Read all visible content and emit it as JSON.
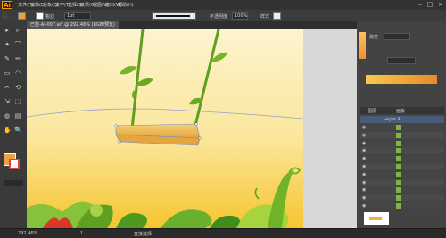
{
  "app": {
    "logo_text": "Ai"
  },
  "menu": {
    "items": [
      "文件(F)",
      "编辑(E)",
      "对象(O)",
      "文字(T)",
      "选择(S)",
      "效果(C)",
      "视图(V)",
      "窗口(W)",
      "帮助(H)"
    ]
  },
  "controlbar": {
    "stroke_label": "描边",
    "stroke_weight": "1pt",
    "opacity_label": "不透明度",
    "opacity_value": "100%",
    "style_label": "样式"
  },
  "document": {
    "tab_label": "已签-AI-007.ai* @ 292.46% (RGB/预览)"
  },
  "panels": {
    "gradient_tab": "渐变",
    "layers_tab": "图层",
    "artboards_tab": "画板",
    "layer_name": "Layer 1"
  },
  "status": {
    "zoom": "292.46%",
    "page": "1",
    "selection_label": "直接选择"
  },
  "colors": {
    "artboard_top": "#fbf3c6",
    "artboard_bottom": "#f7c93a",
    "rope": "#5f9e1f",
    "seat": "#f0b040",
    "accent": "#ff9a00"
  }
}
